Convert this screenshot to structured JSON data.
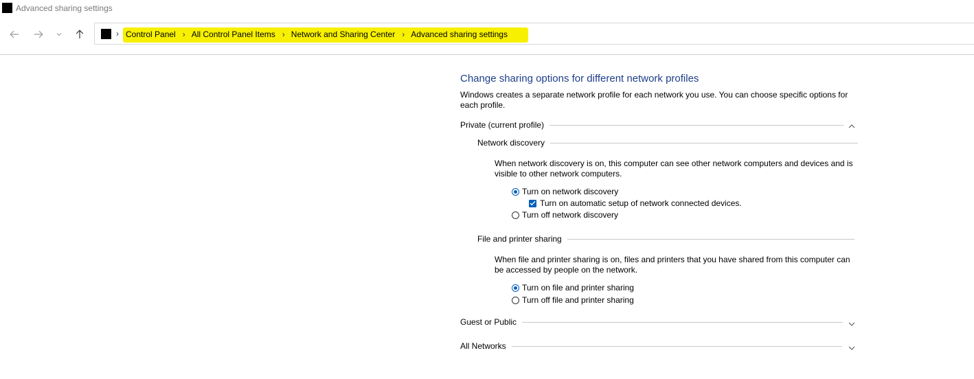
{
  "window": {
    "title": "Advanced sharing settings",
    "icon": "control-panel-icon"
  },
  "navigation": {
    "back_icon": "arrow-left-icon",
    "forward_icon": "arrow-right-icon",
    "recent_icon": "chevron-down-icon",
    "up_icon": "arrow-up-icon",
    "address_icon": "control-panel-icon",
    "separator": "›",
    "breadcrumbs": [
      "Control Panel",
      "All Control Panel Items",
      "Network and Sharing Center",
      "Advanced sharing settings"
    ],
    "highlight_color": "#f7f000"
  },
  "main": {
    "heading": "Change sharing options for different network profiles",
    "intro": "Windows creates a separate network profile for each network you use. You can choose specific options for each profile.",
    "profiles": {
      "private": {
        "label": "Private (current profile)",
        "expanded": true,
        "network_discovery": {
          "label": "Network discovery",
          "description": "When network discovery is on, this computer can see other network computers and devices and is visible to other network computers.",
          "on_option": "Turn on network discovery",
          "on_selected": true,
          "auto_setup": "Turn on automatic setup of network connected devices.",
          "auto_setup_checked": true,
          "off_option": "Turn off network discovery"
        },
        "file_printer_sharing": {
          "label": "File and printer sharing",
          "description": "When file and printer sharing is on, files and printers that you have shared from this computer can be accessed by people on the network.",
          "on_option": "Turn on file and printer sharing",
          "on_selected": true,
          "off_option": "Turn off file and printer sharing"
        }
      },
      "guest_public": {
        "label": "Guest or Public",
        "expanded": false
      },
      "all_networks": {
        "label": "All Networks",
        "expanded": false
      }
    }
  },
  "colors": {
    "heading": "#1e3e8a",
    "accent": "#005fb8"
  }
}
